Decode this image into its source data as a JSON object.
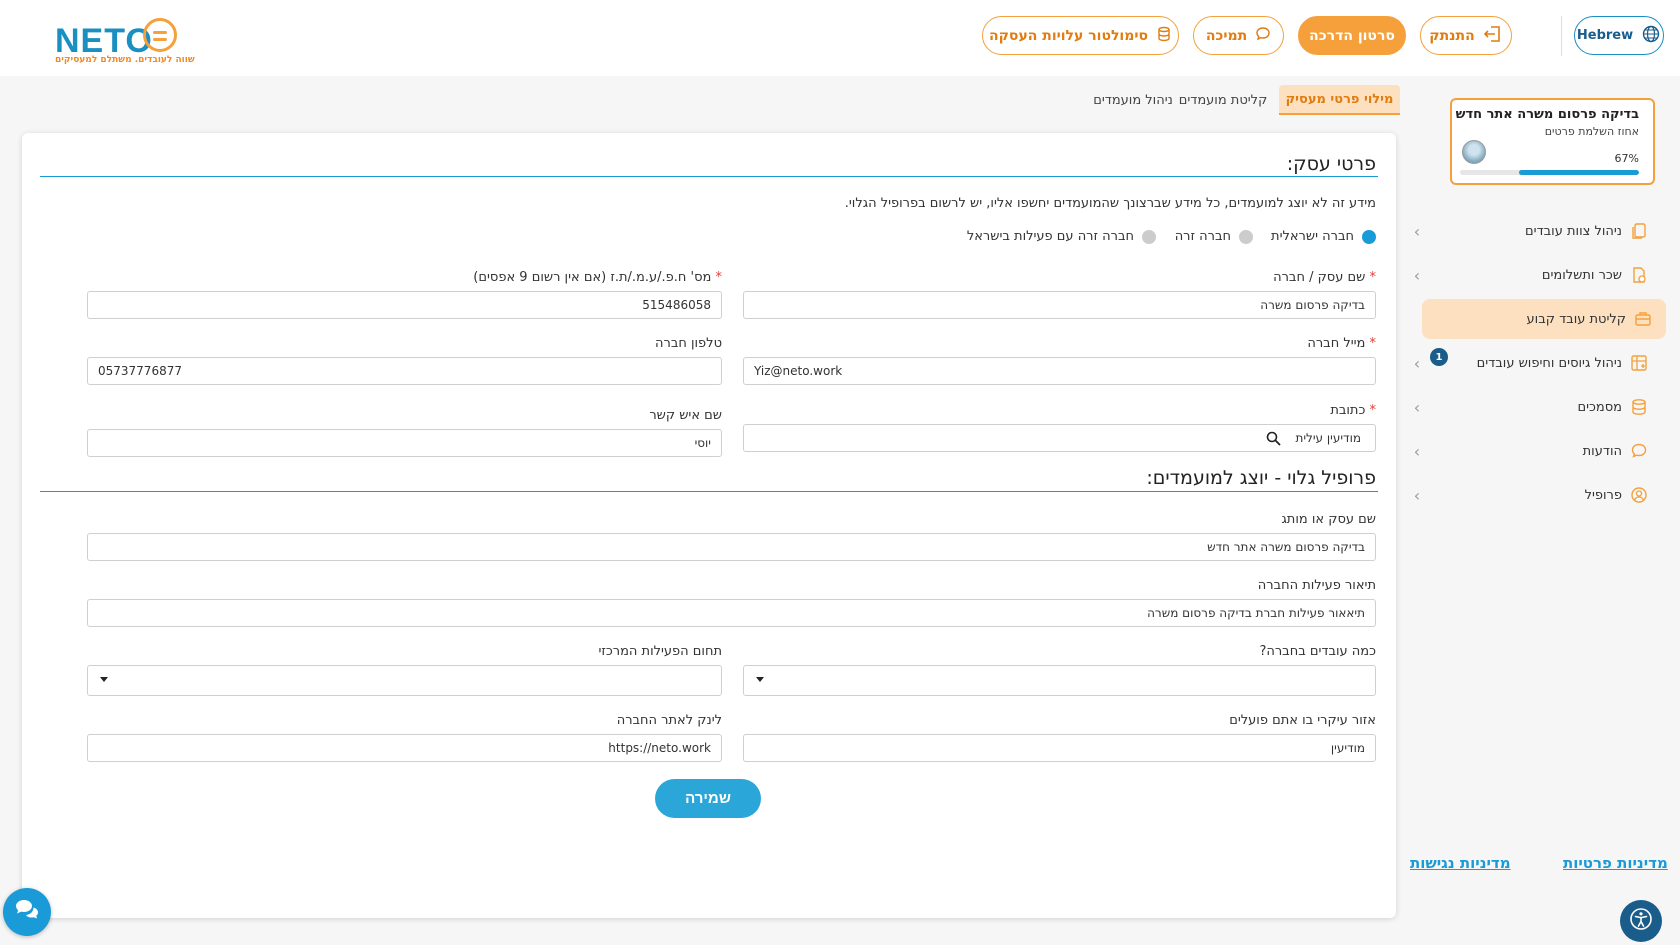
{
  "header": {
    "logo_word": "NETO",
    "logo_tagline": "שווה לעובדים. משתלם למעסיקים",
    "language_label": "Hebrew",
    "login_label": "התנתק",
    "tutorial_label": "סרטון הדרכה",
    "support_label": "תמיכה",
    "simulator_label": "סימולטור עלויות העסקה",
    "accent_color": "#f5a03a",
    "brand_color": "#1a8fc2"
  },
  "sidebar": {
    "progress": {
      "title": "בדיקה פרסום משרה אתר חדש",
      "subtitle": "אחוז השלמת פרטים",
      "percent_label": "67%",
      "percent": 0.67
    },
    "items": [
      {
        "label": "ניהול צוות עובדים",
        "icon": "documents-icon"
      },
      {
        "label": "שכר ותשלומים",
        "icon": "payslip-icon"
      },
      {
        "label": "קליטת עובד קבוע",
        "icon": "briefcase-icon"
      },
      {
        "label": "ניהול גיוסים וחיפוש עובדים",
        "icon": "grid-plus-icon",
        "badge": "1"
      },
      {
        "label": "מסמכים",
        "icon": "database-icon"
      },
      {
        "label": "הודעות",
        "icon": "chat-icon"
      },
      {
        "label": "פרופיל",
        "icon": "user-circle-icon"
      }
    ],
    "footer_privacy": "מדיניות פרטיות",
    "footer_accessibility": "מדיניות נגישות"
  },
  "tabs": [
    {
      "label": "מילוי פרטי מעסיק"
    },
    {
      "label": "קליטת מועמדים"
    },
    {
      "label": "ניהול מועמדים"
    }
  ],
  "form": {
    "business_section_title": "פרטי עסק:",
    "info_text": "מידע זה לא יוצג למועמדים, כל מידע שברצונך שהמועמדים יחשפו אליו, יש לרשום בפרופיל הגלוי.",
    "company_types": [
      "חברה ישראלית",
      "חברה זרה",
      "חברה זרה עם פעילות בישראל"
    ],
    "business_name_label": "שם עסק / חברה",
    "business_name_value": "בדיקה פרסום משרה",
    "company_id_label": "מס' ח.פ./ע.מ./ת.ז (אם אין רשום 9 אפסים)",
    "company_id_value": "515486058",
    "company_email_label": "מייל חברה",
    "company_email_value": "Yiz@neto.work",
    "company_phone_label": "טלפון חברה",
    "company_phone_value": "05737776877",
    "address_label": "כתובת",
    "address_value": "מודיעין עילית",
    "contact_name_label": "שם איש קשר",
    "contact_name_value": "יוסי",
    "required_mark": "*",
    "profile_section_title": "פרופיל גלוי - יוצג למועמדים:",
    "brand_name_label": "שם עסק או מותג",
    "brand_name_value": "בדיקה פרסום משרה אתר חדש",
    "activity_desc_label": "תיאור פעילות החברה",
    "activity_desc_value": "תיאאור פעילות חברת בדיקה פרסום משרה",
    "employee_count_label": "כמה עובדים בחברה?",
    "employee_count_value": "",
    "main_field_label": "תחום הפעילות המרכזי",
    "main_field_value": "",
    "region_label": "אזור עיקרי בו אתם פועלים",
    "region_value": "מודיעין",
    "website_label": "לינק לאתר החברה",
    "website_value": "https://neto.work",
    "save_label": "שמירה"
  }
}
